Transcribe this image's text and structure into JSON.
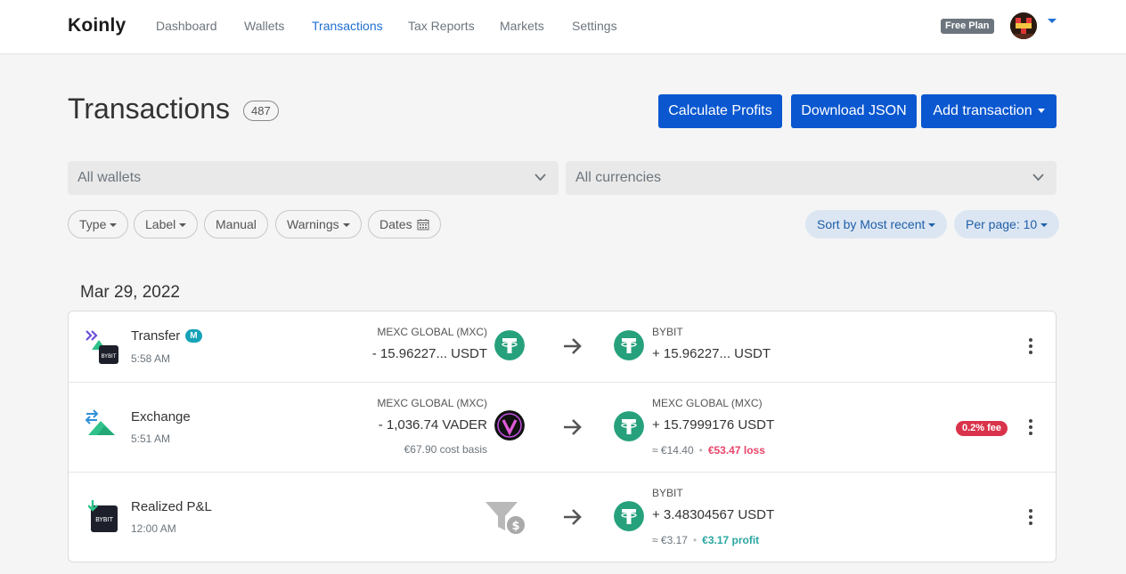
{
  "app": {
    "logo": "Koinly",
    "plan": "Free Plan"
  },
  "nav": {
    "items": [
      "Dashboard",
      "Wallets",
      "Transactions",
      "Tax Reports",
      "Markets",
      "Settings"
    ],
    "active": "Transactions"
  },
  "header": {
    "title": "Transactions",
    "count": "487",
    "buttons": {
      "calculate": "Calculate Profits",
      "download": "Download JSON",
      "add": "Add transaction"
    }
  },
  "filters": {
    "wallets": "All wallets",
    "currencies": "All currencies",
    "pills": [
      "Type",
      "Label",
      "Manual",
      "Warnings",
      "Dates"
    ],
    "sort": "Sort by Most recent",
    "per_page": "Per page: 10"
  },
  "date_heading": "Mar 29, 2022",
  "transactions": [
    {
      "type": "Transfer",
      "badge": "M",
      "time": "5:58 AM",
      "from_wallet": "MEXC GLOBAL (MXC)",
      "from_amount": "- 15.96227... USDT",
      "from_coin": "usdt-icon",
      "to_wallet": "BYBIT",
      "to_amount": "+ 15.96227... USDT",
      "to_coin": "usdt-icon"
    },
    {
      "type": "Exchange",
      "time": "5:51 AM",
      "from_wallet": "MEXC GLOBAL (MXC)",
      "from_amount": "- 1,036.74 VADER",
      "from_sub": "€67.90 cost basis",
      "from_coin": "vader-icon",
      "to_wallet": "MEXC GLOBAL (MXC)",
      "to_amount": "+ 15.7999176 USDT",
      "to_value": "≈ €14.40",
      "to_result": "€53.47 loss",
      "to_coin": "usdt-icon",
      "fee": "0.2% fee"
    },
    {
      "type": "Realized P&L",
      "time": "12:00 AM",
      "from_coin": "funnel-icon",
      "to_wallet": "BYBIT",
      "to_amount": "+ 3.48304567 USDT",
      "to_value": "≈ €3.17",
      "to_result": "€3.17 profit",
      "to_coin": "usdt-icon"
    }
  ],
  "colors": {
    "primary": "#0a57d0",
    "usdt": "#26a17b",
    "loss": "#e8456b",
    "profit": "#2aa6a0",
    "fee": "#d9334b"
  }
}
